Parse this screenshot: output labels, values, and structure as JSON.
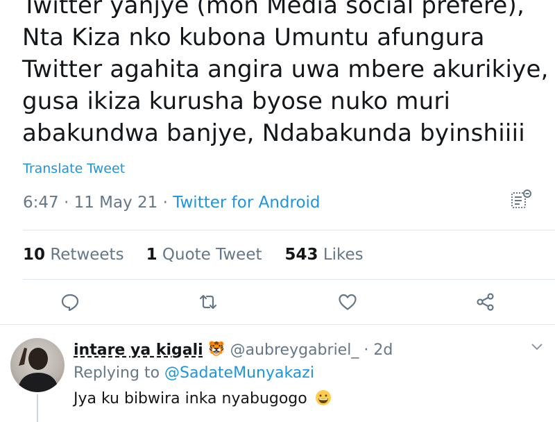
{
  "tweet": {
    "lines": [
      "Twitter yanjye (mon Media social préféré),",
      "Nta Kiza nko kubona Umuntu afungura",
      "Twitter agahita angira uwa mbere akurikiye,",
      "gusa ikiza kurusha byose nuko muri",
      "abakundwa banjye, Ndabakunda byinshiiii"
    ],
    "translate_label": "Translate Tweet",
    "time": "6:47",
    "dot1": " · ",
    "date": "11 May 21",
    "dot2": " · ",
    "source": "Twitter for Android"
  },
  "stats": {
    "retweets_count": "10",
    "retweets_label": " Retweets",
    "quotes_count": "1",
    "quotes_label": " Quote Tweet",
    "likes_count": "543",
    "likes_label": " Likes"
  },
  "icons": {
    "analytics": "analytics-icon",
    "reply": "reply-icon",
    "retweet": "retweet-icon",
    "like": "heart-icon",
    "share": "share-icon",
    "more": "chevron-down-icon"
  },
  "reply": {
    "display_name": "intare ya kigali",
    "badge_emoji": "🐯",
    "handle": "@aubreygabriel_",
    "dot": " · ",
    "age": "2d",
    "replying_prefix": "Replying to ",
    "replying_to": "@SadateMunyakazi",
    "text": "Jya ku bibwira inka nyabugogo"
  },
  "colors": {
    "link": "#1b95e0",
    "secondary": "#657786",
    "primary_text": "#14171a",
    "divider": "#e1e8ed"
  }
}
